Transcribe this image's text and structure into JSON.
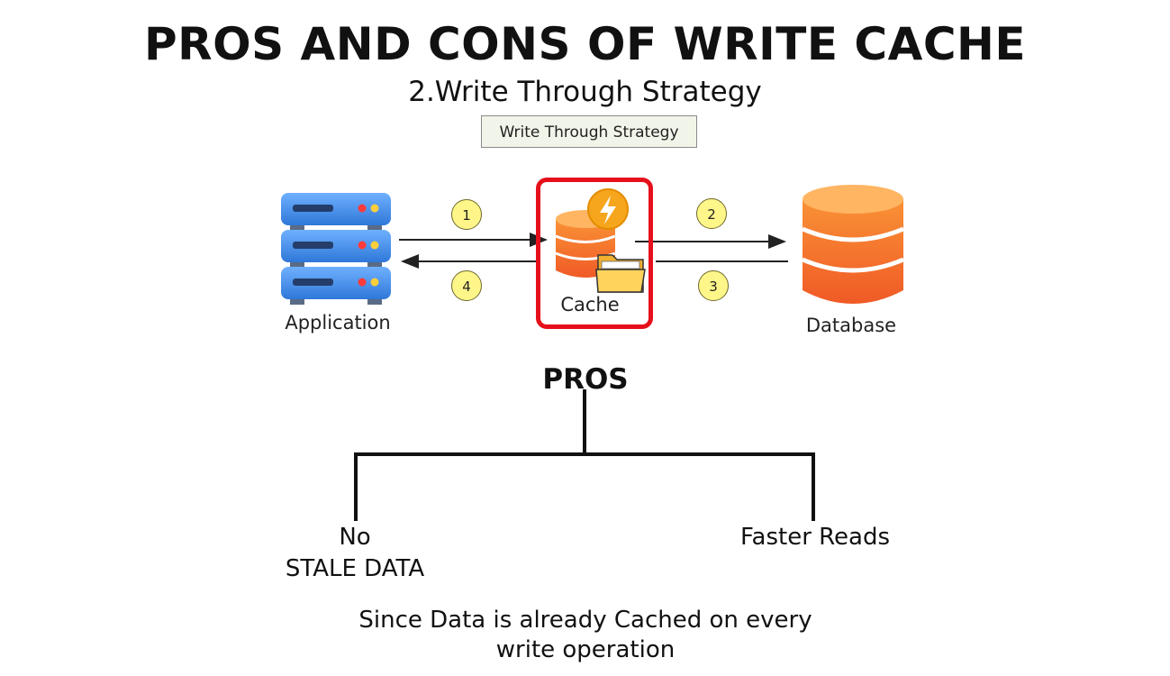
{
  "title": "PROS AND CONS OF WRITE CACHE",
  "subtitle": "2.Write Through Strategy",
  "diagram": {
    "label_box": "Write Through Strategy",
    "application_label": "Application",
    "cache_label": "Cache",
    "database_label": "Database",
    "steps": [
      "1",
      "2",
      "3",
      "4"
    ],
    "colors": {
      "server_blue": "#3d8ae8",
      "cache_orange": "#f57a2a",
      "frame_red": "#e5101b",
      "step_yellow": "#fff68a",
      "bolt_gold": "#f6a61c",
      "folder_yellow": "#ffc94a"
    }
  },
  "pros": {
    "heading": "PROS",
    "left_branch": {
      "line1": "No",
      "line2": "STALE DATA"
    },
    "right_branch": "Faster Reads",
    "note_line1": "Since Data is already Cached on every",
    "note_line2": "write operation"
  }
}
